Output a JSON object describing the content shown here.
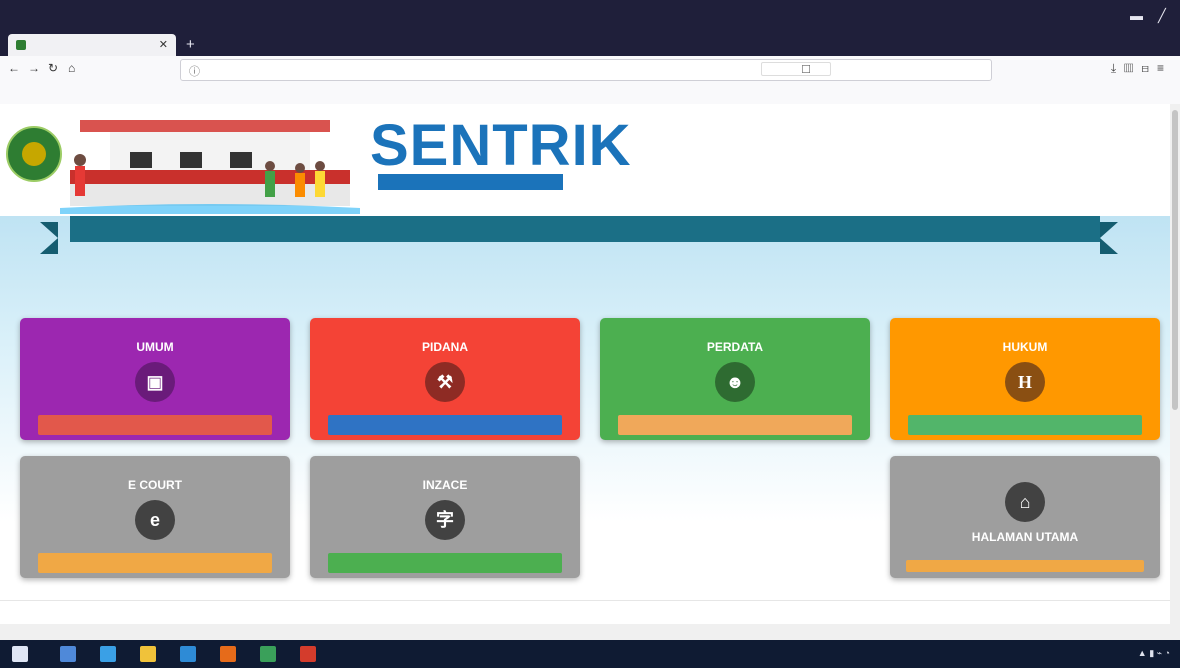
{
  "browser": {
    "title_text": "",
    "tab_label": "",
    "url": "",
    "search_placeholder": "",
    "bookmarks": [
      "",
      "",
      "",
      "",
      "",
      "",
      "",
      "",
      "",
      ""
    ]
  },
  "header": {
    "brand_title": "SENTRIK",
    "brand_sub": ""
  },
  "hero": {
    "ribbon": "",
    "subtitle": ""
  },
  "cards": [
    {
      "line1": "",
      "line2": "UMUM",
      "icon": "document-icon",
      "glyph": "▣",
      "button": "",
      "bg": "#9c27b0",
      "icon_bg": "#6a1b7a",
      "btn_bg": "#e2584b"
    },
    {
      "line1": "",
      "line2": "PIDANA",
      "icon": "gavel-icon",
      "glyph": "⚒",
      "button": "",
      "bg": "#f44336",
      "icon_bg": "#8e2b24",
      "btn_bg": "#2f73c4"
    },
    {
      "line1": "",
      "line2": "PERDATA",
      "icon": "users-icon",
      "glyph": "☻",
      "button": "",
      "bg": "#4caf50",
      "icon_bg": "#2e6b31",
      "btn_bg": "#f0a85a"
    },
    {
      "line1": "",
      "line2": "HUKUM",
      "icon": "h-icon",
      "glyph": "H",
      "button": "",
      "bg": "#ff9800",
      "icon_bg": "#8a4f12",
      "btn_bg": "#52b56a"
    },
    {
      "line1": "",
      "line2": "E COURT",
      "icon": "e-icon",
      "glyph": "e",
      "button": "",
      "bg": "#9e9e9e",
      "icon_bg": "#424242",
      "btn_bg": "#f0a845"
    },
    {
      "line1": "",
      "line2": "INZACE",
      "icon": "text-icon",
      "glyph": "字",
      "button": "",
      "bg": "#9e9e9e",
      "icon_bg": "#424242",
      "btn_bg": "#4caf50"
    },
    {
      "line1": "",
      "line2": "HALAMAN UTAMA",
      "icon": "home-icon",
      "glyph": "⌂",
      "button": "",
      "bg": "#9e9e9e",
      "icon_bg": "#424242",
      "btn_bg": "#f0a845"
    }
  ],
  "footer": {
    "text": ""
  }
}
